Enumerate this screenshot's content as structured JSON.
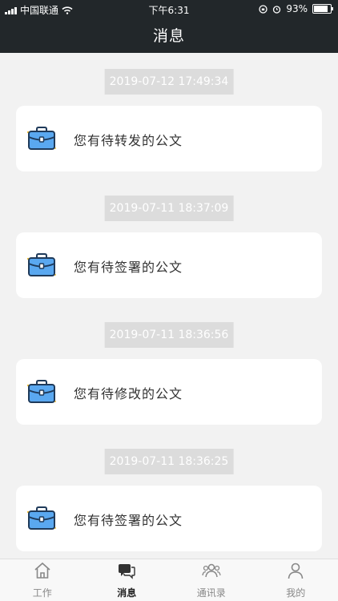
{
  "status_bar": {
    "carrier": "中国联通",
    "time": "下午6:31",
    "battery": "93%",
    "battery_level": 0.93
  },
  "header": {
    "title": "消息"
  },
  "messages": [
    {
      "timestamp": "2019-07-12 17:49:34",
      "text": "您有待转发的公文"
    },
    {
      "timestamp": "2019-07-11 18:37:09",
      "text": "您有待签署的公文"
    },
    {
      "timestamp": "2019-07-11 18:36:56",
      "text": "您有待修改的公文"
    },
    {
      "timestamp": "2019-07-11 18:36:25",
      "text": "您有待签署的公文"
    }
  ],
  "tabbar": {
    "items": [
      {
        "label": "工作",
        "icon": "home-icon"
      },
      {
        "label": "消息",
        "icon": "chat-icon",
        "active": true
      },
      {
        "label": "通讯录",
        "icon": "contacts-icon"
      },
      {
        "label": "我的",
        "icon": "profile-icon"
      }
    ]
  },
  "colors": {
    "header_bg": "#22272a",
    "briefcase_blue": "#5aa8f0",
    "active_tab": "#222222"
  }
}
